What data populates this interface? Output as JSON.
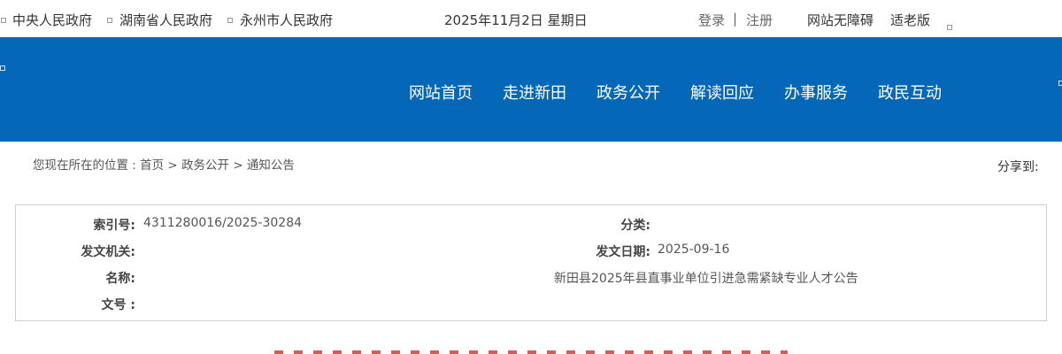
{
  "topbar": {
    "links": [
      "中央人民政府",
      "湖南省人民政府",
      "永州市人民政府"
    ],
    "date": "2025年11月2日 星期日",
    "login": "登录",
    "separator": "|",
    "register": "注册",
    "accessible": "网站无障碍",
    "elderly": "适老版"
  },
  "nav": {
    "items": [
      "网站首页",
      "走进新田",
      "政务公开",
      "解读回应",
      "办事服务",
      "政民互动"
    ]
  },
  "breadcrumb": {
    "text": "您现在所在的位置 : 首页 > 政务公开 > 通知公告"
  },
  "share_label": "分享到:",
  "info": {
    "index_label": "索引号:",
    "index_value": "4311280016/2025-30284",
    "category_label": "分类:",
    "category_value": "",
    "issuer_label": "发文机关:",
    "issuer_value": "",
    "date_label": "发文日期:",
    "date_value": "2025-09-16",
    "name_label": "名称:",
    "name_value": "新田县2025年县直事业单位引进急需紧缺专业人才公告",
    "docno_label": "文号 :",
    "docno_value": ""
  }
}
